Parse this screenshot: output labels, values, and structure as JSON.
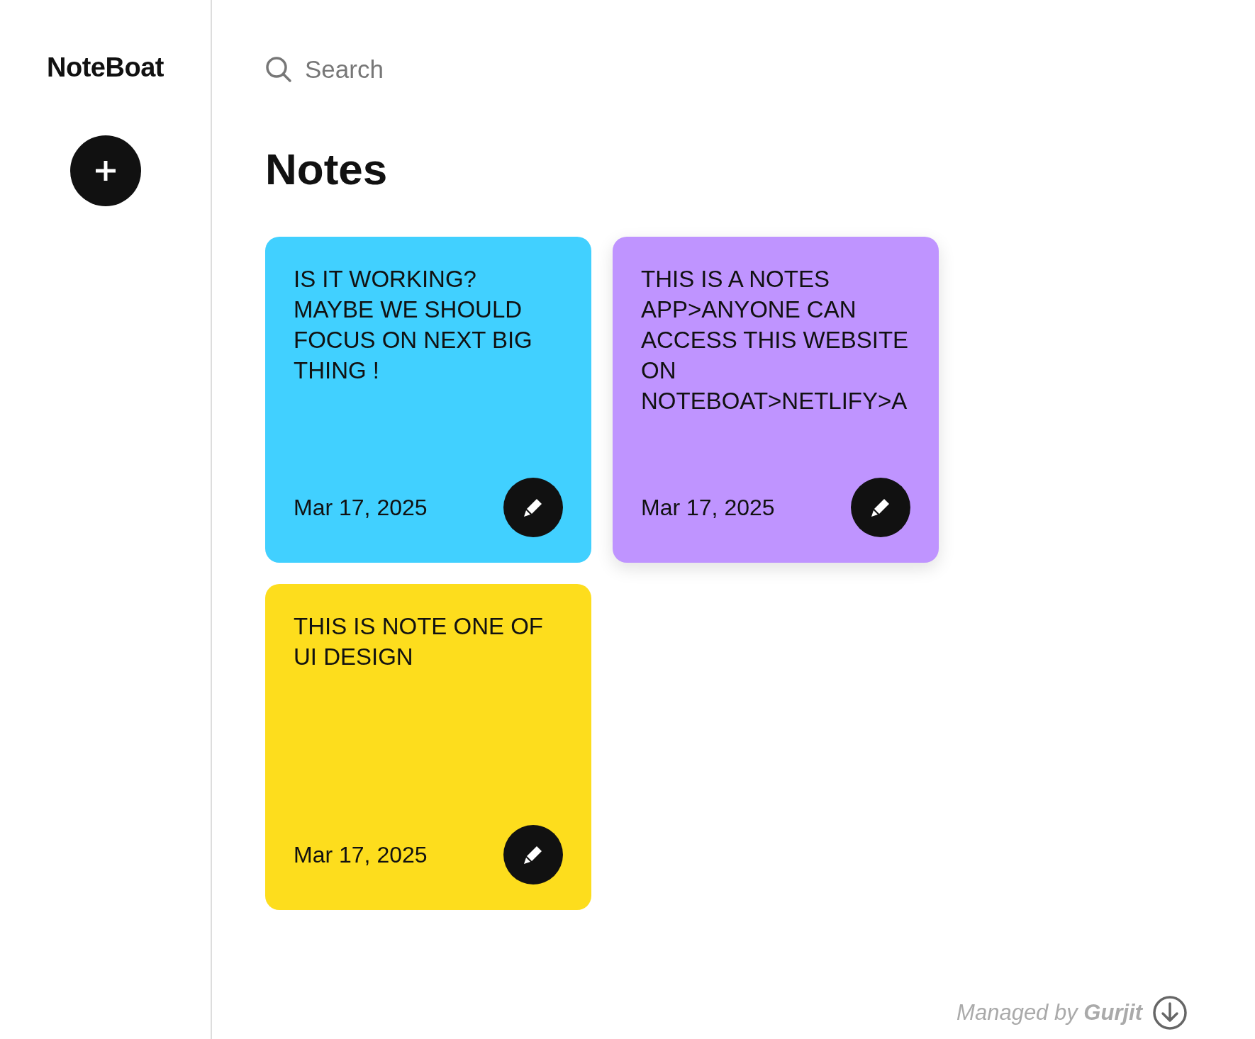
{
  "sidebar": {
    "logo": "NoteBoat"
  },
  "search": {
    "placeholder": "Search"
  },
  "heading": "Notes",
  "notes": [
    {
      "text": "IS IT WORKING? MAYBE WE SHOULD FOCUS ON NEXT BIG THING !",
      "date": "Mar 17, 2025",
      "color": "#41d0ff",
      "hovered": false
    },
    {
      "text": "THIS IS A NOTES APP>ANYONE CAN ACCESS THIS WEBSITE ON NOTEBOAT>NETLIFY>A",
      "date": "Mar 17, 2025",
      "color": "#bf94ff",
      "hovered": true
    },
    {
      "text": "THIS IS NOTE ONE OF UI DESIGN",
      "date": "Mar 17, 2025",
      "color": "#fddd1d",
      "hovered": false
    }
  ],
  "footer": {
    "text": "Managed by **Gurjit**"
  }
}
